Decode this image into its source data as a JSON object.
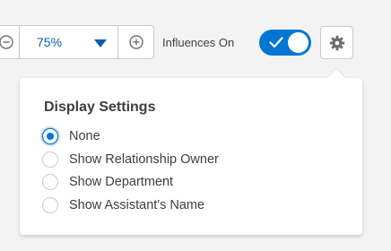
{
  "toolbar": {
    "zoom_value": "75%",
    "influences_label": "Influences On",
    "influences_on": true
  },
  "icons": {
    "zoom_out": "minus-circle-icon",
    "zoom_in": "plus-circle-icon",
    "dropdown": "caret-down-icon",
    "toggle_check": "check-icon",
    "settings": "gear-icon"
  },
  "colors": {
    "accent": "#0176d3",
    "zoom_text": "#0b5cab",
    "border": "#c9c9c9",
    "background": "#f3f3f3"
  },
  "popover": {
    "title": "Display Settings",
    "options": [
      {
        "label": "None",
        "selected": true
      },
      {
        "label": "Show Relationship Owner",
        "selected": false
      },
      {
        "label": "Show Department",
        "selected": false
      },
      {
        "label": "Show Assistant's Name",
        "selected": false
      }
    ]
  }
}
